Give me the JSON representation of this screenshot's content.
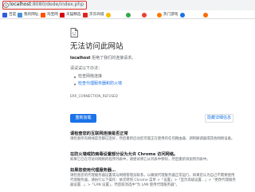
{
  "address_bar": {
    "url_host": "localhost",
    "url_path": ":8080/dede/index.php"
  },
  "bookmarks": [
    {
      "label": "百度",
      "color": "#2e5bde",
      "shape": "square"
    },
    {
      "label": "我的网址",
      "color": "#4a90d9",
      "shape": "square"
    },
    {
      "label": "淘宝网",
      "color": "#ff5000",
      "shape": "square"
    },
    {
      "label": "天猫精选",
      "color": "#d6000f",
      "shape": "square"
    },
    {
      "label": "京东商城",
      "color": "#e1251b",
      "shape": "square"
    },
    {
      "label": "",
      "color": "#fbbc04",
      "shape": "round"
    },
    {
      "label": "",
      "color": "#34a853",
      "shape": "round"
    },
    {
      "label": "",
      "color": "#ea4335",
      "shape": "round"
    },
    {
      "label": "热门游戏",
      "color": "#ff7a00",
      "shape": "round"
    },
    {
      "label": "",
      "color": "#1a73e8",
      "shape": "round"
    },
    {
      "label": "",
      "color": "#ff6a00",
      "shape": "round"
    }
  ],
  "error_page": {
    "icon": "document-error-icon",
    "title": "无法访问此网站",
    "host": "localhost",
    "refused_message": "拒绝了我们的连接请求。",
    "try_label": "请试试以下办法：",
    "suggestions": [
      {
        "text": "检查网络连接",
        "link": false
      },
      {
        "text": "检查代理服务器和防火墙",
        "link": true
      }
    ],
    "error_code": "ERR_CONNECTION_REFUSED",
    "reload_button": "重新加载",
    "details_button": "隐藏详细信息",
    "sections": [
      {
        "heading": "请检查您的互联网连接是否正常",
        "body": "请检查所有网线是否都已连好，然后重新启动您可能正在使用的任何路由器、调制解调器或其他网络设备。"
      },
      {
        "heading": "在防火墙或防病毒设置部分设为允许 Chrome 访问网络。",
        "body": "如果它已在可访问网络的程序列表中，请尝试将它从列表中移除，然后重新添加到列表中。"
      },
      {
        "heading": "如果您使用代理服务器…",
        "body": "请检查您的代理服务器设置或与网络管理员联系，以确保代理服务器正常运行。如果您认为自己不需要使用代理服务器，请执行以下操作：依次转到 Chrome 菜单 >「设置」>「显示高级设置...」>「更改代理服务器设置...」>「LAN 设置」，然后取消选中\"为 LAN 使用代理服务器\"。"
      }
    ]
  }
}
